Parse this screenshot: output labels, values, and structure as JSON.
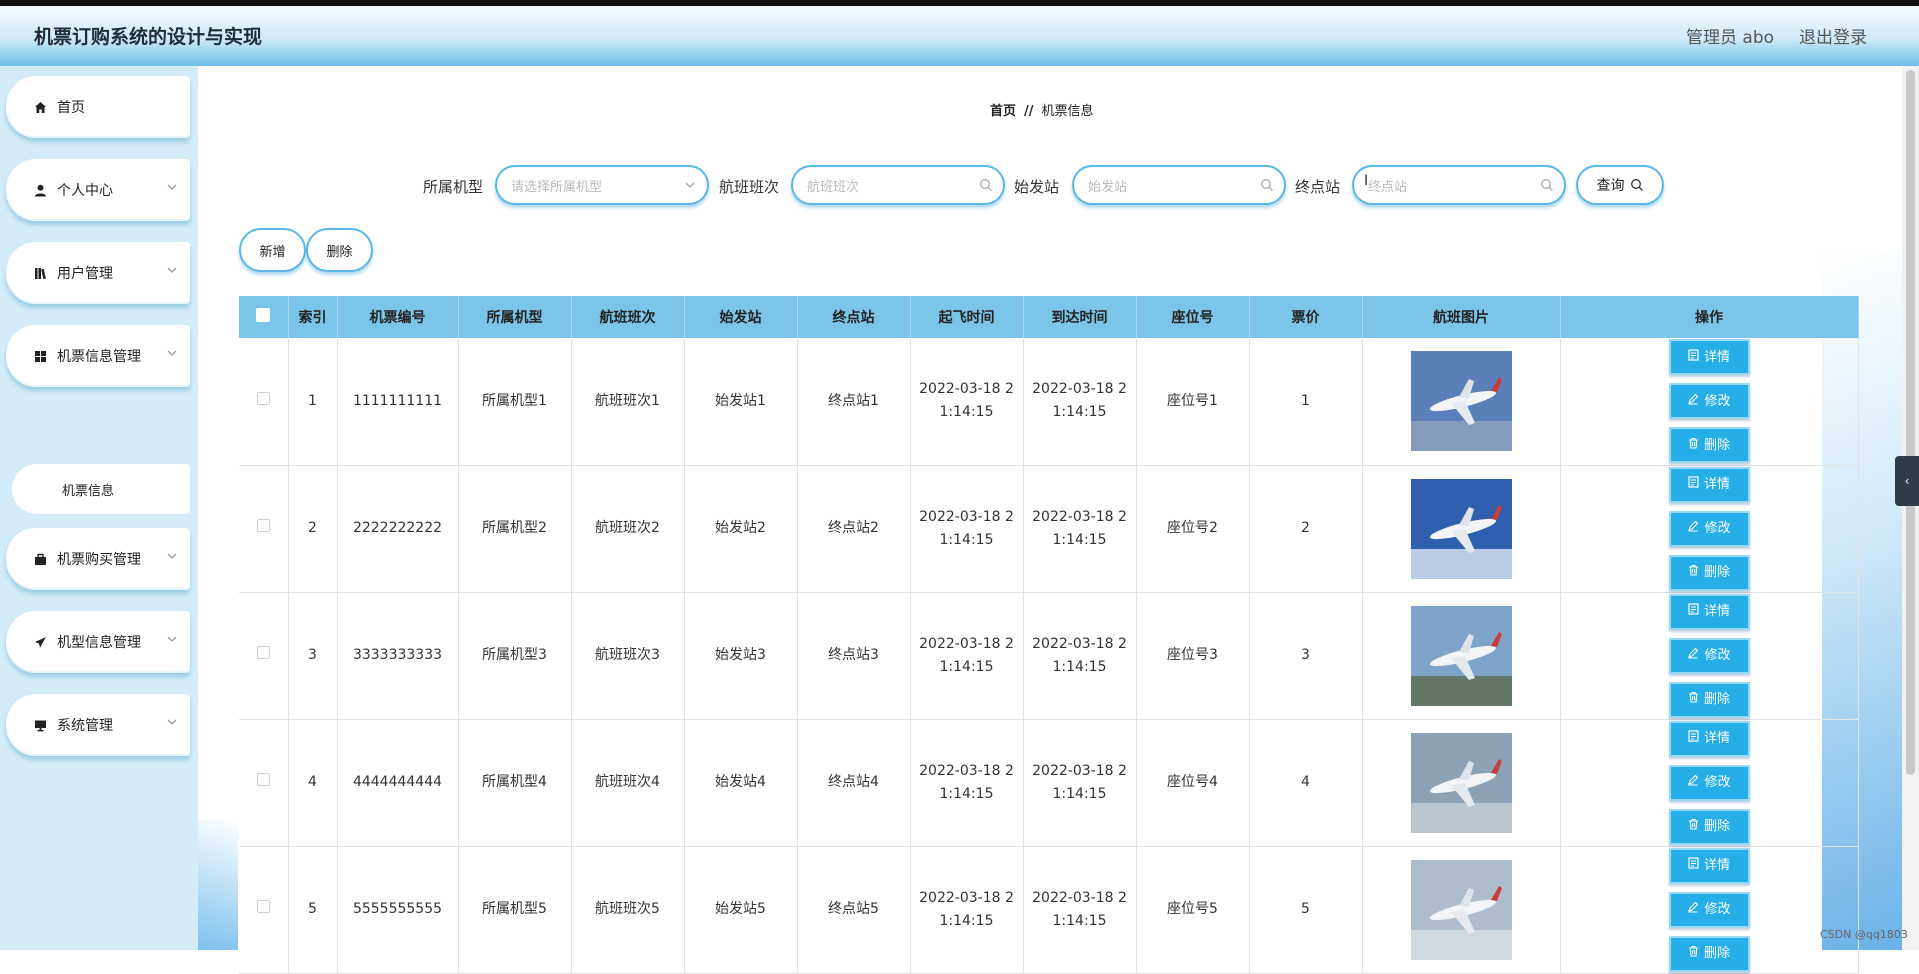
{
  "app_title": "机票订购系统的设计与实现",
  "header": {
    "admin": "管理员 abo",
    "logout": "退出登录"
  },
  "sidebar": {
    "items": [
      {
        "label": "首页",
        "icon": "home-icon"
      },
      {
        "label": "个人中心",
        "icon": "user-icon"
      },
      {
        "label": "用户管理",
        "icon": "books-icon"
      },
      {
        "label": "机票信息管理",
        "icon": "grid-icon"
      },
      {
        "label": "机票购买管理",
        "icon": "briefcase-icon"
      },
      {
        "label": "机型信息管理",
        "icon": "plane-icon"
      },
      {
        "label": "系统管理",
        "icon": "monitor-icon"
      }
    ],
    "sub_item": "机票信息"
  },
  "breadcrumb": {
    "home": "首页",
    "separator": "//",
    "current": "机票信息"
  },
  "filters": {
    "model_label": "所属机型",
    "model_placeholder": "请选择所属机型",
    "flight_label": "航班班次",
    "flight_placeholder": "航班班次",
    "origin_label": "始发站",
    "origin_placeholder": "始发站",
    "dest_label": "终点站",
    "dest_placeholder": "终点站",
    "query": "查询"
  },
  "actions": {
    "add": "新增",
    "delete": "删除"
  },
  "table": {
    "headers": [
      "索引",
      "机票编号",
      "所属机型",
      "航班班次",
      "始发站",
      "终点站",
      "起飞时间",
      "到达时间",
      "座位号",
      "票价",
      "航班图片",
      "操作"
    ],
    "rows": [
      {
        "index": "1",
        "ticket_no": "1111111111",
        "model": "所属机型1",
        "flight": "航班班次1",
        "origin": "始发站1",
        "dest": "终点站1",
        "depart_a": "2022-03-18 2",
        "depart_b": "1:14:15",
        "arrive_a": "2022-03-18 2",
        "arrive_b": "1:14:15",
        "seat": "座位号1",
        "price": "1"
      },
      {
        "index": "2",
        "ticket_no": "2222222222",
        "model": "所属机型2",
        "flight": "航班班次2",
        "origin": "始发站2",
        "dest": "终点站2",
        "depart_a": "2022-03-18 2",
        "depart_b": "1:14:15",
        "arrive_a": "2022-03-18 2",
        "arrive_b": "1:14:15",
        "seat": "座位号2",
        "price": "2"
      },
      {
        "index": "3",
        "ticket_no": "3333333333",
        "model": "所属机型3",
        "flight": "航班班次3",
        "origin": "始发站3",
        "dest": "终点站3",
        "depart_a": "2022-03-18 2",
        "depart_b": "1:14:15",
        "arrive_a": "2022-03-18 2",
        "arrive_b": "1:14:15",
        "seat": "座位号3",
        "price": "3"
      },
      {
        "index": "4",
        "ticket_no": "4444444444",
        "model": "所属机型4",
        "flight": "航班班次4",
        "origin": "始发站4",
        "dest": "终点站4",
        "depart_a": "2022-03-18 2",
        "depart_b": "1:14:15",
        "arrive_a": "2022-03-18 2",
        "arrive_b": "1:14:15",
        "seat": "座位号4",
        "price": "4"
      },
      {
        "index": "5",
        "ticket_no": "5555555555",
        "model": "所属机型5",
        "flight": "航班班次5",
        "origin": "始发站5",
        "dest": "终点站5",
        "depart_a": "2022-03-18 2",
        "depart_b": "1:14:15",
        "arrive_a": "2022-03-18 2",
        "arrive_b": "1:14:15",
        "seat": "座位号5",
        "price": "5"
      }
    ],
    "op_detail": "详情",
    "op_edit": "修改",
    "op_delete": "删除"
  },
  "watermark": "CSDN @qq1803",
  "colors": {
    "accent": "#26aee8",
    "header_row": "#7ac5e8",
    "sidebar_bg": "#d4ecf8"
  }
}
